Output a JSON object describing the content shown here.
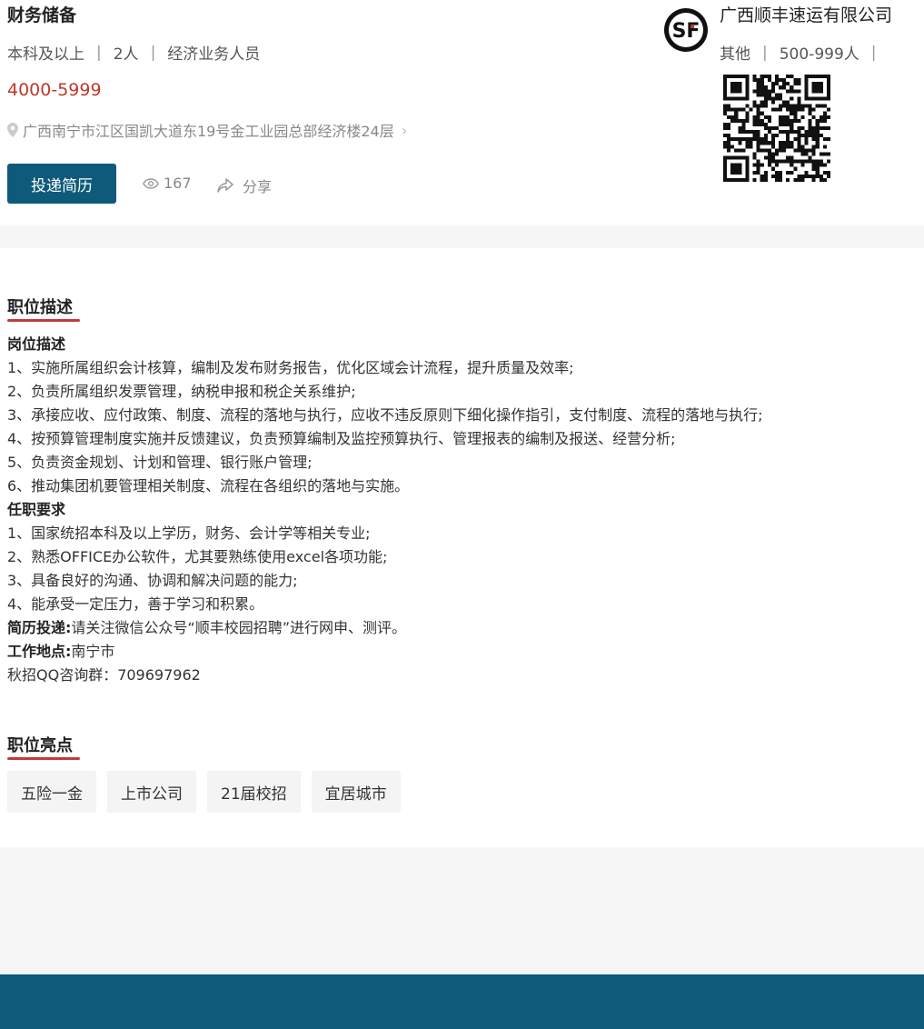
{
  "job": {
    "title": "财务储备",
    "education": "本科及以上",
    "headcount": "2人",
    "category": "经济业务人员",
    "salary": "4000-5999",
    "address": "广西南宁市江区国凯大道东19号金工业园总部经济楼24层",
    "apply_label": "投递简历",
    "views": "167",
    "share_label": "分享"
  },
  "company": {
    "name": "广西顺丰速运有限公司",
    "logo_text": "SF",
    "type": "其他",
    "size": "500-999人"
  },
  "description": {
    "section_title": "职位描述",
    "duty_heading": "岗位描述",
    "duties": [
      "1、实施所属组织会计核算，编制及发布财务报告，优化区域会计流程，提升质量及效率;",
      "2、负责所属组织发票管理，纳税申报和税企关系维护;",
      "3、承接应收、应付政策、制度、流程的落地与执行，应收不违反原则下细化操作指引，支付制度、流程的落地与执行;",
      "4、按预算管理制度实施并反馈建议，负责预算编制及监控预算执行、管理报表的编制及报送、经营分析;",
      "5、负责资金规划、计划和管理、银行账户管理;",
      "6、推动集团机要管理相关制度、流程在各组织的落地与实施。"
    ],
    "req_heading": "任职要求",
    "requirements": [
      "1、国家统招本科及以上学历，财务、会计学等相关专业;",
      "2、熟悉OFFICE办公软件，尤其要熟练使用excel各项功能;",
      "3、具备良好的沟通、协调和解决问题的能力;",
      "4、能承受一定压力，善于学习和积累。"
    ],
    "resume_label": "简历投递:",
    "resume_text": "请关注微信公众号“顺丰校园招聘”进行网申、测评。",
    "location_label": "工作地点:",
    "location_text": "南宁市",
    "qq_line": "秋招QQ咨询群：709697962"
  },
  "highlights": {
    "section_title": "职位亮点",
    "tags": [
      "五险一金",
      "上市公司",
      "21届校招",
      "宜居城市"
    ]
  },
  "colors": {
    "accent": "#0e5a7a",
    "salary": "#c0392b",
    "underline": "#c23b3b"
  }
}
